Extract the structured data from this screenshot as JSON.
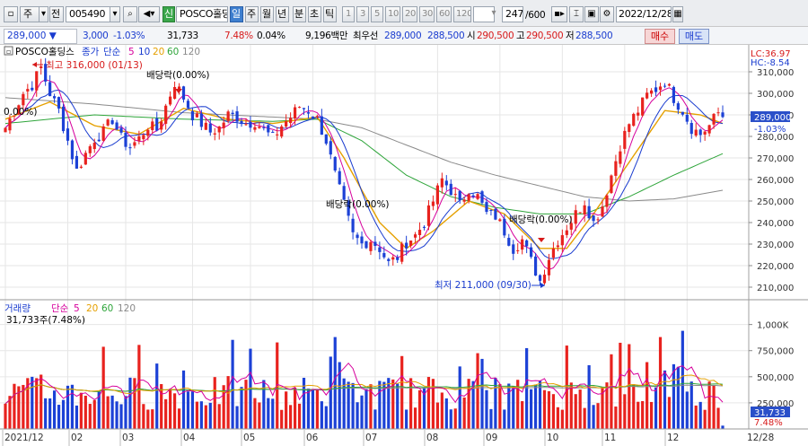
{
  "toolbar": {
    "type_label": "주",
    "code_prefix": "전",
    "code": "005490",
    "sym_label": "신",
    "name": "POSCO홀딩스",
    "periods": [
      "일",
      "주",
      "월",
      "년",
      "분",
      "초",
      "틱"
    ],
    "active_period": "일",
    "intervals": [
      "1",
      "3",
      "5",
      "10",
      "20",
      "30",
      "60",
      "120"
    ],
    "count": "247",
    "count_total": "/600",
    "date": "2022/12/28"
  },
  "quote": {
    "price": "289,000",
    "change": "3,000",
    "change_pct": "-1.03%",
    "volume": "31,733",
    "volume_pct": "7.48%",
    "turnover_pct": "0.04%",
    "amount": "9,196백만",
    "best_label": "최우선",
    "best_ask": "289,000",
    "best_bid": "288,500",
    "open_label": "시",
    "open": "290,500",
    "high_label": "고",
    "high": "290,500",
    "low_label": "저",
    "low": "288,500",
    "buy_label": "매수",
    "sell_label": "매도"
  },
  "legend": {
    "price_name": "POSCO홀딩스",
    "price_ma": [
      "종가",
      "단순",
      "5",
      "10",
      "20",
      "60",
      "120"
    ],
    "volume_name": "거래량",
    "volume_ma": [
      "단순",
      "5",
      "20",
      "60",
      "120"
    ],
    "lc": "LC:36.97",
    "hc": "HC:-8.54",
    "volume_label": "31,733주(7.48%)",
    "current_price_tag": "289,000",
    "current_change_tag": "-1.03%",
    "current_vol_tag": "31,733",
    "current_vol_pct_tag": "7.48%"
  },
  "annotations": {
    "high": "최고 316,000 (01/13)",
    "low": "최저 211,000 (09/30)",
    "dividend": "배당락(0.00%)",
    "dividend_left": "0.00%)"
  },
  "colors": {
    "up": "#e8221e",
    "down": "#1c41d6",
    "ma5": "#d6009c",
    "ma10": "#1a3ccf",
    "ma20": "#e5a000",
    "ma60": "#2ea53a",
    "ma120": "#8a8a8a"
  },
  "chart_data": {
    "type": "candlestick",
    "x_ticks": [
      "2021/12",
      "02",
      "03",
      "04",
      "05",
      "06",
      "07",
      "08",
      "09",
      "10",
      "11",
      "12",
      "12/28"
    ],
    "price_axis": {
      "ylim": [
        205000,
        322000
      ],
      "ticks": [
        "310,000",
        "300,000",
        "290,000",
        "280,000",
        "270,000",
        "260,000",
        "250,000",
        "240,000",
        "230,000",
        "220,000",
        "210,000"
      ]
    },
    "volume_axis": {
      "ylim": [
        0,
        1100000
      ],
      "ticks": [
        "1,000K",
        "750,000",
        "500,000",
        "250,000"
      ]
    },
    "price_anchors": [
      [
        0,
        284000
      ],
      [
        4,
        300000
      ],
      [
        6,
        304000
      ],
      [
        8,
        312000
      ],
      [
        10,
        300000
      ],
      [
        12,
        292000
      ],
      [
        14,
        278000
      ],
      [
        16,
        264000
      ],
      [
        18,
        272000
      ],
      [
        20,
        279000
      ],
      [
        22,
        282000
      ],
      [
        24,
        288000
      ],
      [
        26,
        279000
      ],
      [
        28,
        275000
      ],
      [
        30,
        279000
      ],
      [
        32,
        285000
      ],
      [
        34,
        283000
      ],
      [
        36,
        294000
      ],
      [
        38,
        305000
      ],
      [
        40,
        298000
      ],
      [
        42,
        290000
      ],
      [
        44,
        286000
      ],
      [
        46,
        282000
      ],
      [
        48,
        284000
      ],
      [
        50,
        290000
      ],
      [
        52,
        289000
      ],
      [
        54,
        286000
      ],
      [
        56,
        287000
      ],
      [
        58,
        283000
      ],
      [
        60,
        279000
      ],
      [
        62,
        285000
      ],
      [
        64,
        289000
      ],
      [
        66,
        294000
      ],
      [
        68,
        292000
      ],
      [
        70,
        288000
      ],
      [
        72,
        278000
      ],
      [
        74,
        262000
      ],
      [
        76,
        248000
      ],
      [
        78,
        234000
      ],
      [
        80,
        230000
      ],
      [
        82,
        232000
      ],
      [
        84,
        228000
      ],
      [
        86,
        221000
      ],
      [
        88,
        224000
      ],
      [
        90,
        231000
      ],
      [
        92,
        234000
      ],
      [
        94,
        240000
      ],
      [
        96,
        250000
      ],
      [
        98,
        260000
      ],
      [
        100,
        255000
      ],
      [
        102,
        248000
      ],
      [
        104,
        256000
      ],
      [
        106,
        252000
      ],
      [
        108,
        244000
      ],
      [
        110,
        243000
      ],
      [
        112,
        236000
      ],
      [
        114,
        228000
      ],
      [
        116,
        232000
      ],
      [
        118,
        222000
      ],
      [
        120,
        213000
      ],
      [
        122,
        224000
      ],
      [
        124,
        232000
      ],
      [
        126,
        238000
      ],
      [
        128,
        244000
      ],
      [
        130,
        250000
      ],
      [
        132,
        240000
      ],
      [
        134,
        248000
      ],
      [
        136,
        262000
      ],
      [
        138,
        276000
      ],
      [
        140,
        286000
      ],
      [
        142,
        292000
      ],
      [
        144,
        299000
      ],
      [
        146,
        302000
      ],
      [
        148,
        306000
      ],
      [
        150,
        298000
      ],
      [
        152,
        292000
      ],
      [
        154,
        284000
      ],
      [
        156,
        281000
      ],
      [
        158,
        285000
      ],
      [
        160,
        291000
      ],
      [
        161,
        289000
      ]
    ],
    "ma_anchors": {
      "ma20": [
        [
          0,
          288000
        ],
        [
          10,
          296000
        ],
        [
          20,
          285000
        ],
        [
          30,
          281000
        ],
        [
          40,
          293000
        ],
        [
          50,
          288000
        ],
        [
          60,
          286000
        ],
        [
          70,
          289000
        ],
        [
          76,
          270000
        ],
        [
          84,
          240000
        ],
        [
          90,
          228000
        ],
        [
          96,
          236000
        ],
        [
          104,
          250000
        ],
        [
          112,
          244000
        ],
        [
          120,
          228000
        ],
        [
          126,
          228000
        ],
        [
          132,
          244000
        ],
        [
          140,
          268000
        ],
        [
          148,
          292000
        ],
        [
          156,
          290000
        ],
        [
          161,
          286000
        ]
      ],
      "ma60": [
        [
          0,
          286000
        ],
        [
          20,
          290000
        ],
        [
          40,
          288000
        ],
        [
          60,
          287000
        ],
        [
          70,
          288000
        ],
        [
          80,
          278000
        ],
        [
          90,
          262000
        ],
        [
          100,
          252000
        ],
        [
          110,
          247000
        ],
        [
          120,
          244000
        ],
        [
          130,
          244000
        ],
        [
          140,
          252000
        ],
        [
          150,
          262000
        ],
        [
          161,
          272000
        ]
      ],
      "ma120": [
        [
          0,
          298000
        ],
        [
          20,
          295000
        ],
        [
          40,
          291000
        ],
        [
          60,
          289000
        ],
        [
          70,
          288000
        ],
        [
          80,
          284000
        ],
        [
          90,
          276000
        ],
        [
          100,
          268000
        ],
        [
          110,
          262000
        ],
        [
          120,
          257000
        ],
        [
          130,
          252000
        ],
        [
          140,
          250000
        ],
        [
          150,
          251000
        ],
        [
          161,
          255000
        ]
      ]
    }
  }
}
